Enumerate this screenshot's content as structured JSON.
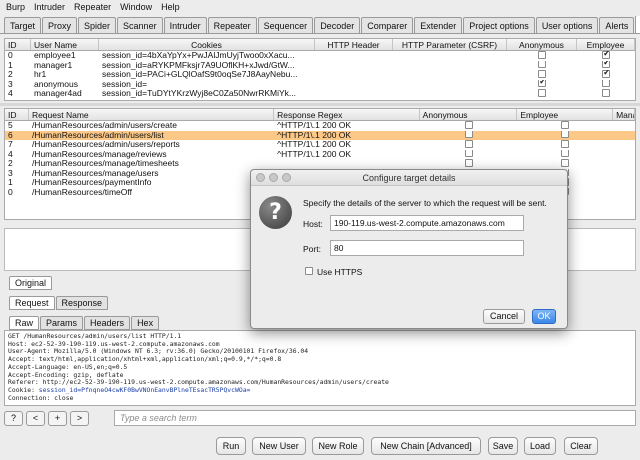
{
  "menu": [
    "Burp",
    "Intruder",
    "Repeater",
    "Window",
    "Help"
  ],
  "tabs": [
    {
      "label": "Target",
      "active": false
    },
    {
      "label": "Proxy",
      "active": false
    },
    {
      "label": "Spider",
      "active": false
    },
    {
      "label": "Scanner",
      "active": false
    },
    {
      "label": "Intruder",
      "active": false
    },
    {
      "label": "Repeater",
      "active": false
    },
    {
      "label": "Sequencer",
      "active": false
    },
    {
      "label": "Decoder",
      "active": false
    },
    {
      "label": "Comparer",
      "active": false
    },
    {
      "label": "Extender",
      "active": false
    },
    {
      "label": "Project options",
      "active": false
    },
    {
      "label": "User options",
      "active": false
    },
    {
      "label": "Alerts",
      "active": false
    },
    {
      "label": "AuthMatrix",
      "active": true
    }
  ],
  "users_table": {
    "columns": [
      "ID",
      "User Name",
      "Cookies",
      "HTTP Header",
      "HTTP Parameter (CSRF)",
      "Anonymous",
      "Employee"
    ],
    "rows": [
      {
        "id": "0",
        "name": "employee1",
        "cookies": "session_id=4bXaYpYx+PwJAlJmUyjTwoo0xXacu...",
        "anonymous": false,
        "employee": true
      },
      {
        "id": "1",
        "name": "manager1",
        "cookies": "session_id=aRYKPMFksjr7A9UOflKH+xJwd/GtW...",
        "anonymous": false,
        "employee": true
      },
      {
        "id": "2",
        "name": "hr1",
        "cookies": "session_id=PACi+GLQlOafS9t0oqSe7J8AayNebu...",
        "anonymous": false,
        "employee": true
      },
      {
        "id": "3",
        "name": "anonymous",
        "cookies": "session_id=",
        "anonymous": true,
        "employee": false
      },
      {
        "id": "4",
        "name": "manager4ad",
        "cookies": "session_id=TuDYtYKrzWyj8eC0Za50NwrRKMiYk...",
        "anonymous": false,
        "employee": false
      }
    ]
  },
  "requests_table": {
    "columns": [
      "ID",
      "Request Name",
      "Response Regex",
      "Anonymous",
      "Employee",
      "Mana"
    ],
    "selected_row": 1,
    "rows": [
      {
        "id": "5",
        "name": "/HumanResources/admin/users/create",
        "regex": "^HTTP/1\\.1 200 OK"
      },
      {
        "id": "6",
        "name": "/HumanResources/admin/users/list",
        "regex": "^HTTP/1\\.1 200 OK"
      },
      {
        "id": "7",
        "name": "/HumanResources/admin/users/reports",
        "regex": "^HTTP/1\\.1 200 OK"
      },
      {
        "id": "4",
        "name": "/HumanResources/manage/reviews",
        "regex": "^HTTP/1\\.1 200 OK"
      },
      {
        "id": "2",
        "name": "/HumanResources/manage/timesheets",
        "regex": ""
      },
      {
        "id": "3",
        "name": "/HumanResources/manage/users",
        "regex": ""
      },
      {
        "id": "1",
        "name": "/HumanResources/paymentInfo",
        "regex": ""
      },
      {
        "id": "0",
        "name": "/HumanResources/timeOff",
        "regex": ""
      }
    ]
  },
  "original_tab": "Original",
  "req_resp_tabs": [
    "Request",
    "Response"
  ],
  "view_tabs": [
    "Raw",
    "Params",
    "Headers",
    "Hex"
  ],
  "request_lines": [
    "GET /HumanResources/admin/users/list HTTP/1.1",
    "Host: ec2-52-39-190-119.us-west-2.compute.amazonaws.com",
    "User-Agent: Mozilla/5.0 (Windows NT 6.3; rv:36.0) Gecko/20100101 Firefox/36.04",
    "Accept: text/html,application/xhtml+xml,application/xml;q=0.9,*/*;q=0.8",
    "Accept-Language: en-US,en;q=0.5",
    "Accept-Encoding: gzip, deflate",
    "Referer: http://ec2-52-39-190-119.us-west-2.compute.amazonaws.com/HumanResources/admin/users/create"
  ],
  "cookie_line_label": "Cookie: ",
  "cookie_line_value": "session_id=PfnqneO4cwKF0BwVNOnEanvBPlneTEsacTR5PQvcWOa=",
  "connection_line": "Connection: close",
  "search": {
    "buttons": [
      "?",
      "<",
      "+",
      ">"
    ],
    "placeholder": "Type a search term"
  },
  "bottom_buttons": [
    "Run",
    "New User",
    "New Role",
    "New Chain [Advanced]",
    "Save",
    "Load",
    "Clear"
  ],
  "dialog": {
    "title": "Configure target details",
    "message": "Specify the details of the server to which the request will be sent.",
    "host_label": "Host:",
    "host_value": "190-119.us-west-2.compute.amazonaws.com",
    "port_label": "Port:",
    "port_value": "80",
    "https_label": "Use HTTPS",
    "use_https": false,
    "cancel_label": "Cancel",
    "ok_label": "OK",
    "accent_color": "#3a86e9"
  },
  "selection_color": "#fbc888"
}
